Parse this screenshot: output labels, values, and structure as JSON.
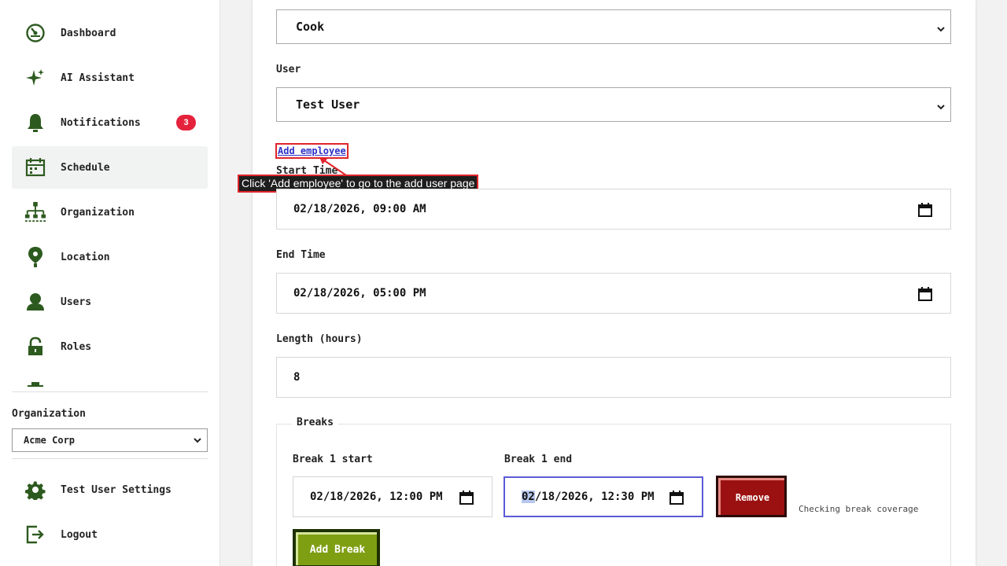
{
  "sidebar": {
    "items": [
      {
        "label": "Dashboard",
        "icon": "dashboard-icon"
      },
      {
        "label": "AI Assistant",
        "icon": "sparkle-icon"
      },
      {
        "label": "Notifications",
        "icon": "bell-icon",
        "badge": "3"
      },
      {
        "label": "Schedule",
        "icon": "calendar-icon",
        "active": true
      },
      {
        "label": "Organization",
        "icon": "org-chart-icon"
      },
      {
        "label": "Location",
        "icon": "map-pin-icon"
      },
      {
        "label": "Users",
        "icon": "user-icon"
      },
      {
        "label": "Roles",
        "icon": "lock-icon"
      }
    ],
    "organization_label": "Organization",
    "organization_value": "Acme Corp",
    "settings_label": "Test User Settings",
    "logout_label": "Logout"
  },
  "form": {
    "role_value": "Cook",
    "user_label": "User",
    "user_value": "Test User",
    "add_employee_link": "Add employee",
    "tooltip": "Click 'Add employee' to go to the add user page",
    "start_label": "Start Time",
    "start_value": "02/18/2026, 09:00 AM",
    "end_label": "End Time",
    "end_value": "02/18/2026, 05:00 PM",
    "length_label": "Length (hours)",
    "length_value": "8",
    "breaks_legend": "Breaks",
    "break1_start_label": "Break 1 start",
    "break1_start_value": "02/18/2026, 12:00 PM",
    "break1_end_label": "Break 1 end",
    "break1_end_selected": "02",
    "break1_end_rest": "/18/2026, 12:30 PM",
    "remove_label": "Remove",
    "status_text": "Checking break coverage",
    "add_break_label": "Add Break"
  },
  "colors": {
    "accent_green": "#2d5a1f",
    "badge_red": "#e5223b",
    "remove_red": "#9b1111",
    "add_break_green": "#7f9f12",
    "highlight_red": "#e0242b"
  }
}
